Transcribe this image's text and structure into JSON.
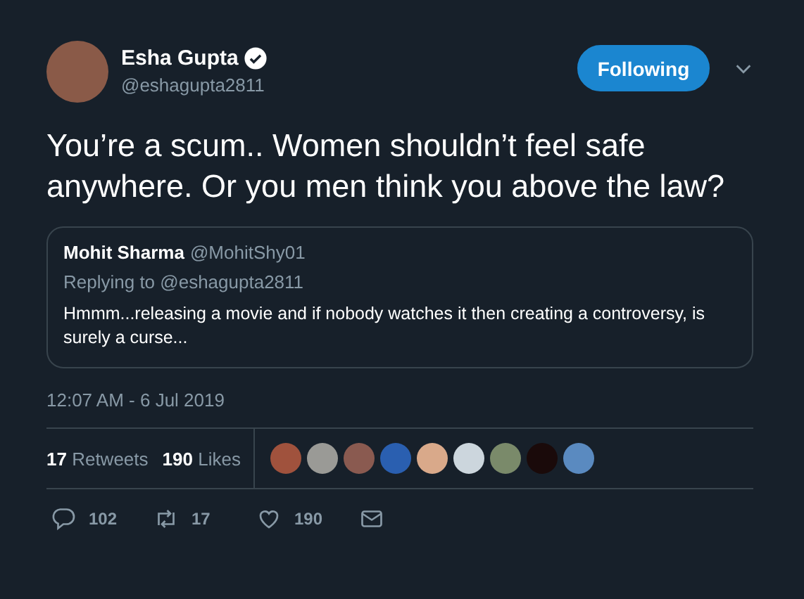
{
  "author": {
    "name": "Esha Gupta",
    "verified": true,
    "handle": "@eshagupta2811"
  },
  "follow_button": {
    "label": "Following",
    "selected": true
  },
  "text": "You’re a scum.. Women shouldn’t feel safe anywhere. Or you men think you above the law?",
  "quoted": {
    "name": "Mohit Sharma",
    "handle": "@MohitShy01",
    "replying_to": "Replying to @eshagupta2811",
    "text": "Hmmm...releasing a movie and if nobody watches it then creating a controversy, is surely a curse..."
  },
  "timestamp": "12:07 AM - 6 Jul 2019",
  "stats": [
    {
      "count": "17",
      "label": "Retweets"
    },
    {
      "count": "190",
      "label": "Likes"
    }
  ],
  "likers": [
    {
      "color": "#a0523d"
    },
    {
      "color": "#9a9a96"
    },
    {
      "color": "#8a5a50"
    },
    {
      "color": "#2a5fb0"
    },
    {
      "color": "#d9a98a"
    },
    {
      "color": "#ccd6dd"
    },
    {
      "color": "#7a8a6a"
    },
    {
      "color": "#1a0a0a"
    },
    {
      "color": "#5a8ac0"
    }
  ],
  "actions": [
    {
      "kind": "reply",
      "count": "102"
    },
    {
      "kind": "retweet",
      "count": "17"
    },
    {
      "kind": "like",
      "count": "190"
    },
    {
      "kind": "message"
    }
  ]
}
